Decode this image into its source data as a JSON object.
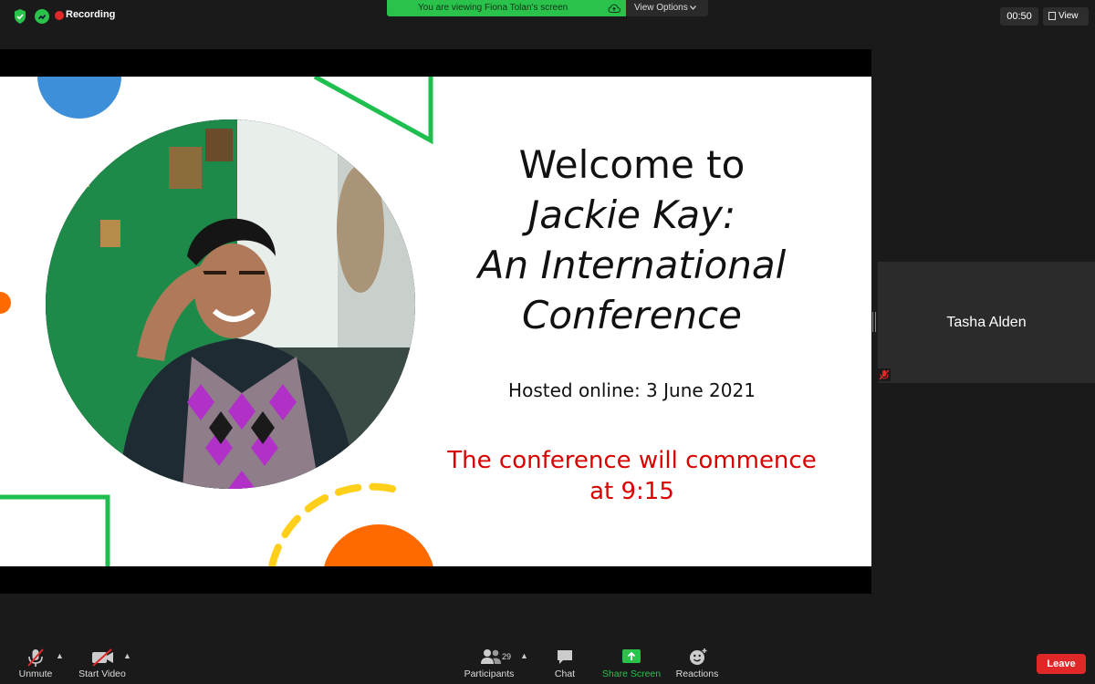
{
  "top_bar": {
    "recording_label": "Recording",
    "viewing_banner": "You are viewing Fiona Tolan's screen",
    "view_options_label": "View Options",
    "timer": "00:50",
    "view_label": "View"
  },
  "slide": {
    "welcome": "Welcome to",
    "title_lines": [
      "Jackie Kay:",
      "An International",
      "Conference"
    ],
    "hosted": "Hosted online: 3 June 2021",
    "commence_lines": [
      "The conference will commence",
      "at 9:15"
    ]
  },
  "participant": {
    "name": "Tasha Alden"
  },
  "toolbar": {
    "unmute": "Unmute",
    "start_video": "Start Video",
    "participants": "Participants",
    "participants_count": "29",
    "chat": "Chat",
    "share_screen": "Share Screen",
    "reactions": "Reactions",
    "leave": "Leave"
  },
  "colors": {
    "share_green": "#2bc24b",
    "leave_red": "#e02828",
    "commence_red": "#d80000",
    "deco_blue": "#3d8fd9",
    "deco_green": "#1fbf4f",
    "deco_orange": "#ff6a00",
    "deco_yellow": "#ffcf1a"
  }
}
